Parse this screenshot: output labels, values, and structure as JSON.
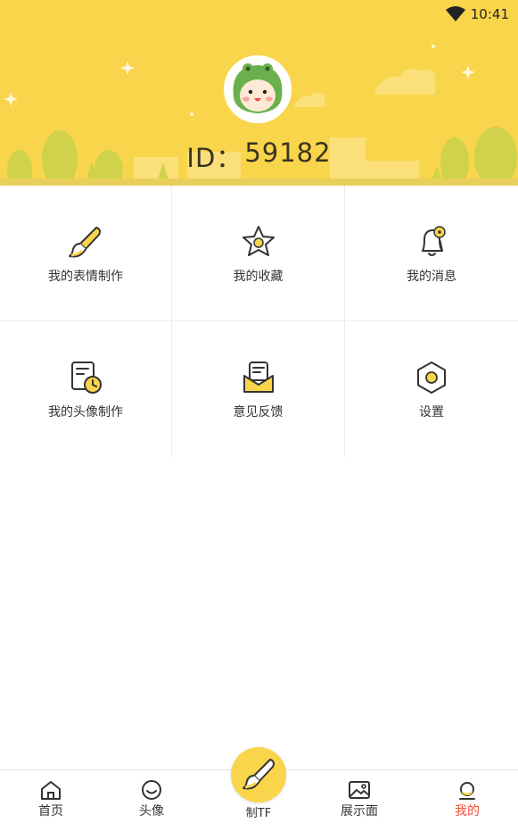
{
  "status_bar": {
    "time": "10:41",
    "icons": [
      "wifi-icon"
    ]
  },
  "header": {
    "avatar_icon": "frog-hood-avatar-icon",
    "id_label": "ID：",
    "id_value": "59182",
    "background": "#f9d54c"
  },
  "menu": [
    {
      "label": "我的表情制作",
      "icon": "brush-icon"
    },
    {
      "label": "我的收藏",
      "icon": "star-icon"
    },
    {
      "label": "我的消息",
      "icon": "bell-icon"
    },
    {
      "label": "我的头像制作",
      "icon": "document-clock-icon"
    },
    {
      "label": "意见反馈",
      "icon": "envelope-icon"
    },
    {
      "label": "设置",
      "icon": "hexagon-settings-icon"
    }
  ],
  "bottom_nav": {
    "items": [
      {
        "label": "首页",
        "icon": "home-icon"
      },
      {
        "label": "头像",
        "icon": "smile-icon"
      },
      {
        "label": "制TF",
        "icon": "brush-icon"
      },
      {
        "label": "展示面",
        "icon": "image-icon"
      },
      {
        "label": "我的",
        "icon": "profile-icon"
      }
    ],
    "active_color": "#f2503d",
    "accent": "#f9d54c"
  }
}
